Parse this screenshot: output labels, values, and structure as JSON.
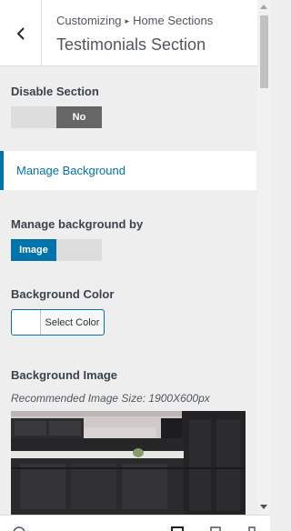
{
  "header": {
    "breadcrumb_root": "Customizing",
    "breadcrumb_sep": "▸",
    "breadcrumb_leaf": "Home Sections",
    "title": "Testimonials Section"
  },
  "disable_section": {
    "label": "Disable Section",
    "off_label": "",
    "on_label": "No",
    "value": "No"
  },
  "manage_background_panel": {
    "label": "Manage Background"
  },
  "manage_background_by": {
    "label": "Manage background by",
    "selected_label": "Image",
    "other_label": "",
    "value": "Image"
  },
  "background_color": {
    "label": "Background Color",
    "button_label": "Select Color"
  },
  "background_image": {
    "label": "Background Image",
    "description": "Recommended Image Size: 1900X600px"
  },
  "colors": {
    "accent": "#0073aa",
    "toggle_on": "#666666",
    "toggle_off": "#dddddd"
  }
}
